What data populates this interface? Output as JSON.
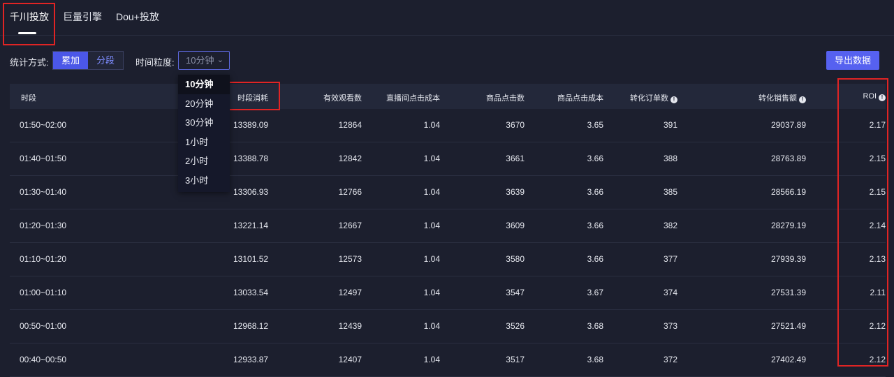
{
  "tabs": [
    {
      "label": "千川投放",
      "active": true
    },
    {
      "label": "巨量引擎",
      "active": false
    },
    {
      "label": "Dou+投放",
      "active": false
    }
  ],
  "toolbar": {
    "stat_mode_label": "统计方式:",
    "stat_mode_options": [
      "累加",
      "分段"
    ],
    "granularity_label": "时间粒度:",
    "granularity_value": "10分钟",
    "export_label": "导出数据"
  },
  "dropdown": {
    "options": [
      "10分钟",
      "20分钟",
      "30分钟",
      "1小时",
      "2小时",
      "3小时"
    ],
    "selected": "10分钟"
  },
  "table": {
    "columns": [
      "时段",
      "时段消耗",
      "有效观看数",
      "直播间点击成本",
      "商品点击数",
      "商品点击成本",
      "转化订单数",
      "转化销售额",
      "ROI"
    ],
    "rows": [
      [
        "01:50~02:00",
        "13389.09",
        "12864",
        "1.04",
        "3670",
        "3.65",
        "391",
        "29037.89",
        "2.17"
      ],
      [
        "01:40~01:50",
        "13388.78",
        "12842",
        "1.04",
        "3661",
        "3.66",
        "388",
        "28763.89",
        "2.15"
      ],
      [
        "01:30~01:40",
        "13306.93",
        "12766",
        "1.04",
        "3639",
        "3.66",
        "385",
        "28566.19",
        "2.15"
      ],
      [
        "01:20~01:30",
        "13221.14",
        "12667",
        "1.04",
        "3609",
        "3.66",
        "382",
        "28279.19",
        "2.14"
      ],
      [
        "01:10~01:20",
        "13101.52",
        "12573",
        "1.04",
        "3580",
        "3.66",
        "377",
        "27939.39",
        "2.13"
      ],
      [
        "01:00~01:10",
        "13033.54",
        "12497",
        "1.04",
        "3547",
        "3.67",
        "374",
        "27531.39",
        "2.11"
      ],
      [
        "00:50~01:00",
        "12968.12",
        "12439",
        "1.04",
        "3526",
        "3.68",
        "373",
        "27521.49",
        "2.12"
      ],
      [
        "00:40~00:50",
        "12933.87",
        "12407",
        "1.04",
        "3517",
        "3.68",
        "372",
        "27402.49",
        "2.12"
      ]
    ]
  },
  "colors": {
    "background": "#1c1f2e",
    "accent": "#5661f0",
    "highlight_box": "#e02424"
  }
}
